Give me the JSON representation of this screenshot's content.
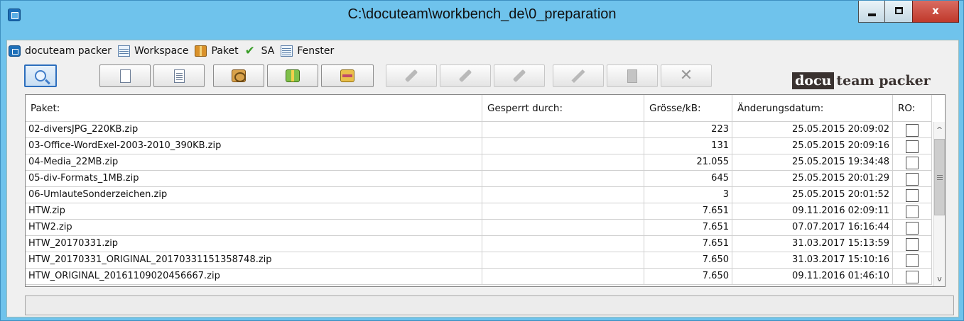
{
  "window": {
    "title": "C:\\docuteam\\workbench_de\\0_preparation"
  },
  "menu": {
    "items": [
      {
        "label": "docuteam packer",
        "icon": "packer-icon"
      },
      {
        "label": "Workspace",
        "icon": "workspace-icon"
      },
      {
        "label": "Paket",
        "icon": "package-icon"
      },
      {
        "label": "SA",
        "icon": "checkmark-icon"
      },
      {
        "label": "Fenster",
        "icon": "window-list-icon"
      }
    ]
  },
  "toolbar": {
    "buttons": [
      {
        "icon": "search-icon",
        "state": "active"
      },
      {
        "icon": "new-document-icon",
        "state": "enabled"
      },
      {
        "icon": "document-list-icon",
        "state": "enabled"
      },
      {
        "icon": "package-open-icon",
        "state": "enabled"
      },
      {
        "icon": "package-green-icon",
        "state": "enabled"
      },
      {
        "icon": "package-yellow-icon",
        "state": "enabled"
      },
      {
        "icon": "wrench-icon",
        "state": "disabled"
      },
      {
        "icon": "wrench-2-icon",
        "state": "disabled"
      },
      {
        "icon": "wrench-3-icon",
        "state": "disabled"
      },
      {
        "icon": "pencil-icon",
        "state": "disabled"
      },
      {
        "icon": "clipboard-icon",
        "state": "disabled"
      },
      {
        "icon": "delete-icon",
        "state": "disabled"
      }
    ]
  },
  "brand": {
    "part_a": "docu",
    "part_b": "team packer"
  },
  "table": {
    "columns": [
      "Paket:",
      "Gesperrt durch:",
      "Grösse/kB:",
      "Änderungsdatum:",
      "RO:"
    ],
    "rows": [
      {
        "paket": "02-diversJPG_220KB.zip",
        "locked_by": "",
        "size": "223",
        "date": "25.05.2015 20:09:02",
        "ro": false
      },
      {
        "paket": "03-Office-WordExel-2003-2010_390KB.zip",
        "locked_by": "",
        "size": "131",
        "date": "25.05.2015 20:09:16",
        "ro": false
      },
      {
        "paket": "04-Media_22MB.zip",
        "locked_by": "",
        "size": "21.055",
        "date": "25.05.2015 19:34:48",
        "ro": false
      },
      {
        "paket": "05-div-Formats_1MB.zip",
        "locked_by": "",
        "size": "645",
        "date": "25.05.2015 20:01:29",
        "ro": false
      },
      {
        "paket": "06-UmlauteSonderzeichen.zip",
        "locked_by": "",
        "size": "3",
        "date": "25.05.2015 20:01:52",
        "ro": false
      },
      {
        "paket": "HTW.zip",
        "locked_by": "",
        "size": "7.651",
        "date": "09.11.2016 02:09:11",
        "ro": false
      },
      {
        "paket": "HTW2.zip",
        "locked_by": "",
        "size": "7.651",
        "date": "07.07.2017 16:16:44",
        "ro": false
      },
      {
        "paket": "HTW_20170331.zip",
        "locked_by": "",
        "size": "7.651",
        "date": "31.03.2017 15:13:59",
        "ro": false
      },
      {
        "paket": "HTW_20170331_ORIGINAL_20170331151358748.zip",
        "locked_by": "",
        "size": "7.650",
        "date": "31.03.2017 15:10:16",
        "ro": false
      },
      {
        "paket": "HTW_ORIGINAL_20161109020456667.zip",
        "locked_by": "",
        "size": "7.650",
        "date": "09.11.2016 01:46:10",
        "ro": false
      }
    ]
  },
  "status": {
    "text": ""
  }
}
